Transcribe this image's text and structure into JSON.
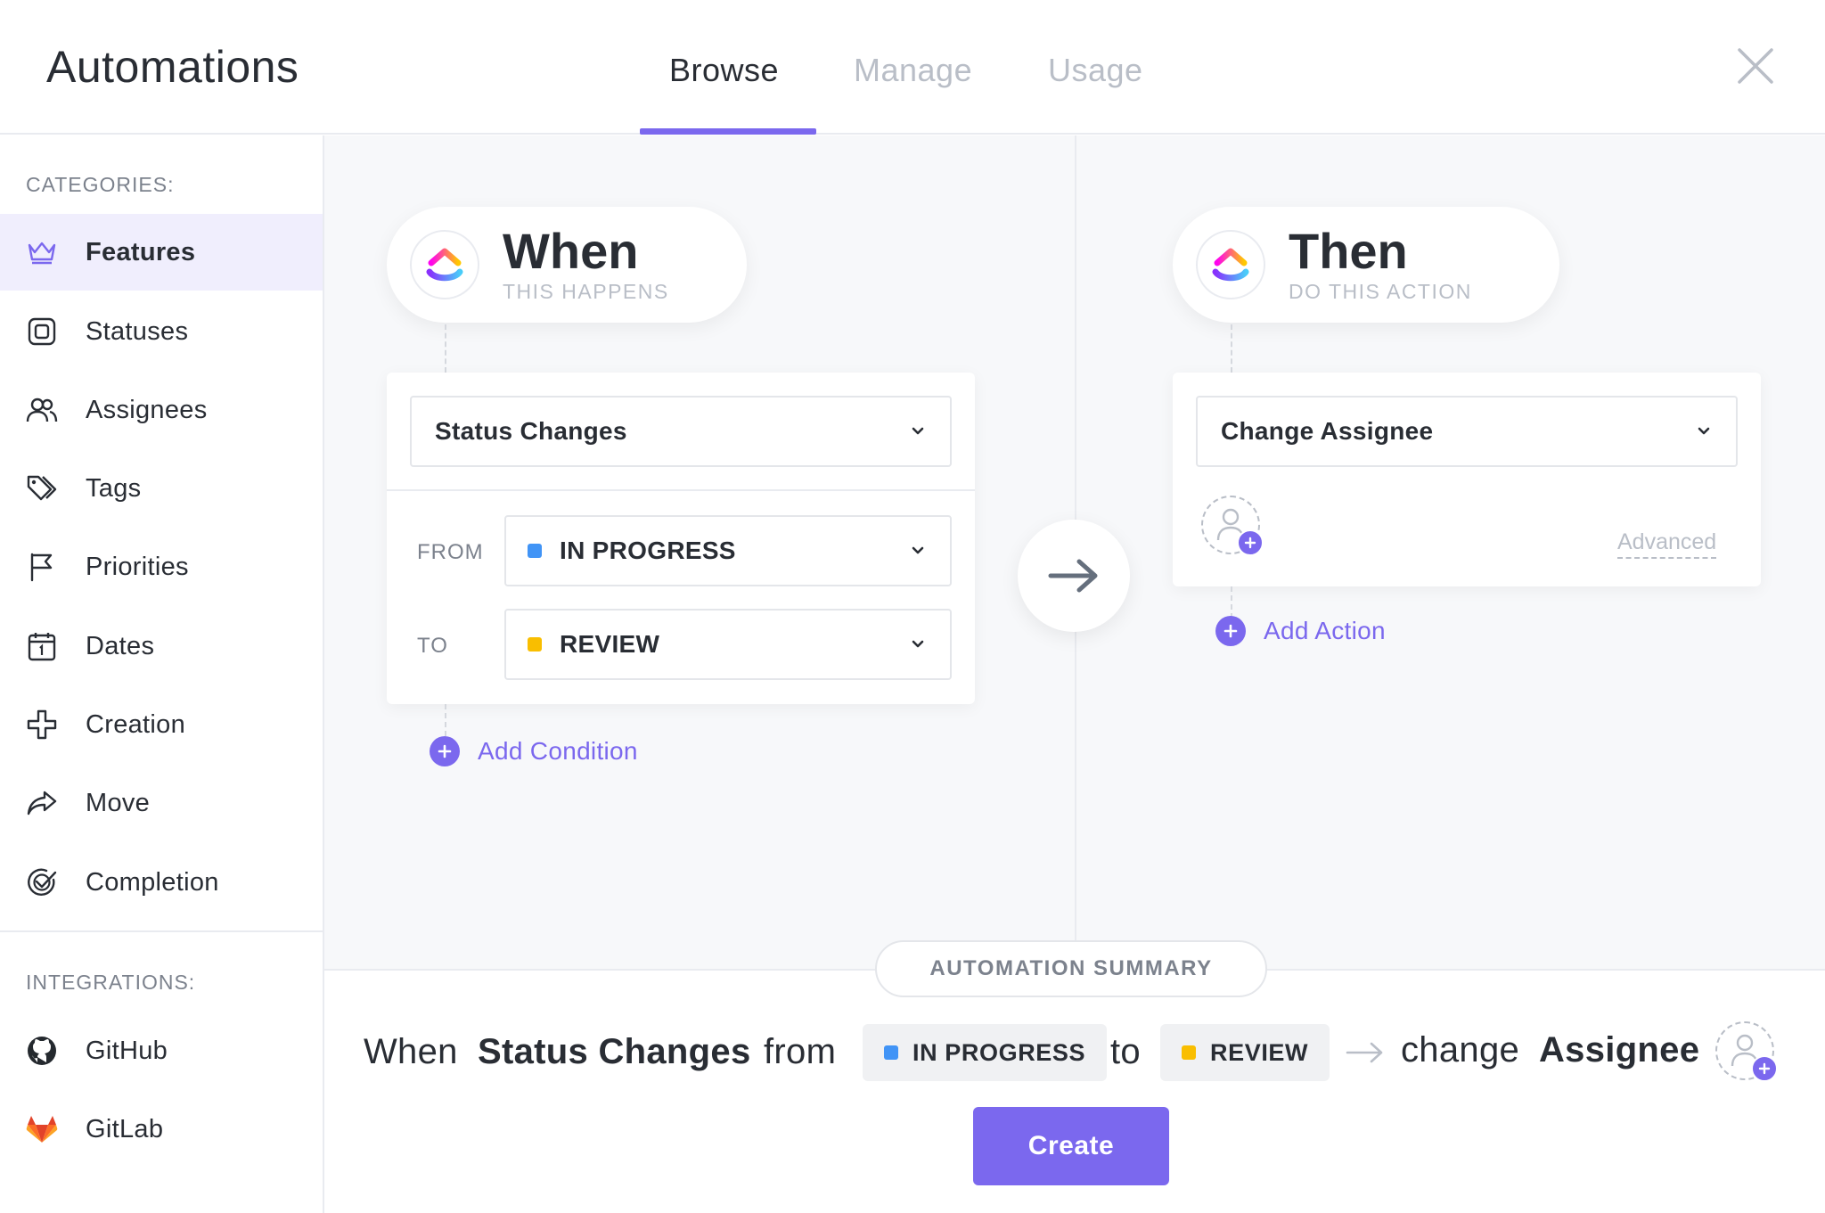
{
  "header": {
    "title": "Automations",
    "tabs": [
      {
        "label": "Browse",
        "active": true
      },
      {
        "label": "Manage",
        "active": false
      },
      {
        "label": "Usage",
        "active": false
      }
    ],
    "close_icon": "close-icon"
  },
  "sidebar": {
    "categories_label": "CATEGORIES:",
    "categories": [
      {
        "label": "Features",
        "icon": "crown-icon",
        "active": true
      },
      {
        "label": "Statuses",
        "icon": "status-square-icon"
      },
      {
        "label": "Assignees",
        "icon": "users-icon"
      },
      {
        "label": "Tags",
        "icon": "tags-icon"
      },
      {
        "label": "Priorities",
        "icon": "flag-icon"
      },
      {
        "label": "Dates",
        "icon": "calendar-icon"
      },
      {
        "label": "Creation",
        "icon": "plus-outline-icon"
      },
      {
        "label": "Move",
        "icon": "share-arrow-icon"
      },
      {
        "label": "Completion",
        "icon": "check-circle-icon"
      }
    ],
    "integrations_label": "INTEGRATIONS:",
    "integrations": [
      {
        "label": "GitHub",
        "icon": "github-icon"
      },
      {
        "label": "GitLab",
        "icon": "gitlab-icon"
      }
    ]
  },
  "trigger": {
    "title": "When",
    "subtitle": "THIS HAPPENS",
    "select_value": "Status Changes",
    "from_label": "FROM",
    "from_value": "IN PROGRESS",
    "to_label": "TO",
    "to_value": "REVIEW",
    "add_condition": "Add Condition"
  },
  "action": {
    "title": "Then",
    "subtitle": "DO THIS ACTION",
    "select_value": "Change Assignee",
    "advanced": "Advanced",
    "add_action": "Add Action"
  },
  "summary": {
    "chip": "AUTOMATION SUMMARY",
    "when": "When",
    "trigger": "Status Changes",
    "from": "from",
    "from_status": "IN PROGRESS",
    "to": "to",
    "to_status": "REVIEW",
    "change": "change",
    "target": "Assignee",
    "create_button": "Create"
  },
  "colors": {
    "accent": "#7b68ee",
    "in_progress": "#4194f6",
    "review": "#f9be00"
  }
}
